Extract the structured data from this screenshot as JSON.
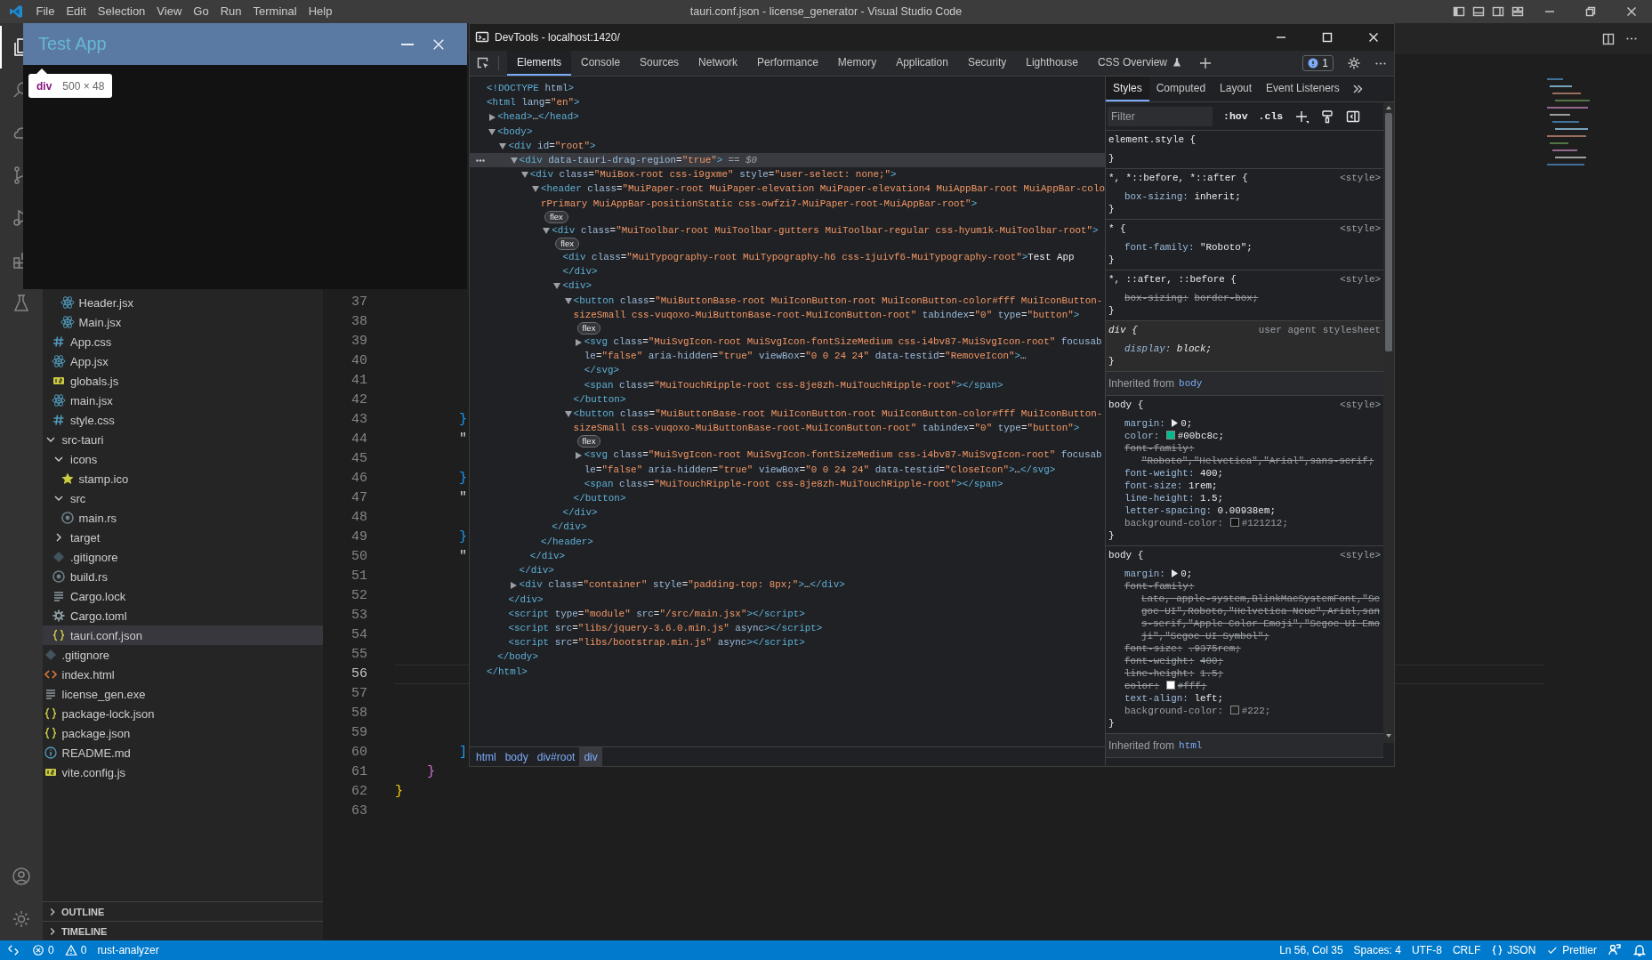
{
  "menubar": {
    "items": [
      "File",
      "Edit",
      "Selection",
      "View",
      "Go",
      "Run",
      "Terminal",
      "Help"
    ],
    "title": "tauri.conf.json - license_generator - Visual Studio Code"
  },
  "activity_bar": {
    "top": [
      {
        "kind": "explorer",
        "selected": true
      },
      {
        "kind": "search",
        "selected": false
      },
      {
        "kind": "remote",
        "selected": false
      },
      {
        "kind": "scm",
        "selected": false
      },
      {
        "kind": "debug",
        "selected": false
      },
      {
        "kind": "extensions",
        "selected": false
      },
      {
        "kind": "testing",
        "selected": false
      }
    ],
    "bottom": [
      {
        "kind": "account"
      },
      {
        "kind": "manage"
      }
    ]
  },
  "explorer": {
    "tree": [
      {
        "children": [
          {
            "children": [
              {
                "name": "Header.jsx",
                "kind": "react",
                "selected": false
              },
              {
                "name": "Main.jsx",
                "kind": "react",
                "selected": false
              }
            ]
          },
          {
            "name": "App.css",
            "kind": "css",
            "selected": false
          },
          {
            "name": "App.jsx",
            "kind": "react",
            "selected": false
          },
          {
            "name": "globals.js",
            "kind": "js",
            "selected": false
          },
          {
            "name": "main.jsx",
            "kind": "react",
            "selected": false
          },
          {
            "name": "style.css",
            "kind": "css",
            "selected": false
          }
        ]
      },
      {
        "name": "src-tauri",
        "kind": "folder",
        "expanded": true,
        "selected": false,
        "children": [
          {
            "name": "icons",
            "kind": "folder",
            "expanded": true,
            "selected": false,
            "children": [
              {
                "name": "stamp.ico",
                "kind": "image",
                "selected": false
              }
            ]
          },
          {
            "name": "src",
            "kind": "folder",
            "expanded": true,
            "selected": false,
            "children": [
              {
                "name": "main.rs",
                "kind": "rust",
                "selected": false
              }
            ]
          },
          {
            "name": "target",
            "kind": "folder",
            "expanded": false,
            "selected": false
          },
          {
            "name": ".gitignore",
            "kind": "git",
            "selected": false
          },
          {
            "name": "build.rs",
            "kind": "rust",
            "selected": false
          },
          {
            "name": "Cargo.lock",
            "kind": "lines",
            "selected": false
          },
          {
            "name": "Cargo.toml",
            "kind": "gear",
            "selected": false
          },
          {
            "name": "tauri.conf.json",
            "kind": "json",
            "selected": true
          }
        ]
      },
      {
        "name": ".gitignore",
        "kind": "git",
        "selected": false
      },
      {
        "name": "index.html",
        "kind": "html",
        "selected": false
      },
      {
        "name": "license_gen.exe",
        "kind": "lines",
        "selected": false
      },
      {
        "name": "package-lock.json",
        "kind": "json",
        "selected": false
      },
      {
        "name": "package.json",
        "kind": "json",
        "selected": false
      },
      {
        "name": "README.md",
        "kind": "info",
        "selected": false
      },
      {
        "name": "vite.config.js",
        "kind": "js",
        "selected": false
      }
    ],
    "sections": [
      {
        "label": "OUTLINE",
        "expanded": false
      },
      {
        "label": "TIMELINE",
        "expanded": false
      }
    ]
  },
  "editor": {
    "lines": [
      {
        "number": "37",
        "current": false
      },
      {
        "number": "38",
        "current": false
      },
      {
        "number": "39",
        "current": false
      },
      {
        "number": "40",
        "current": false
      },
      {
        "number": "41",
        "current": false
      },
      {
        "number": "42",
        "current": false
      },
      {
        "number": "43",
        "current": false,
        "text": "        }",
        "color": "#179fff"
      },
      {
        "number": "44",
        "current": false,
        "text": "        \""
      },
      {
        "number": "45",
        "current": false
      },
      {
        "number": "46",
        "current": false,
        "text": "        }",
        "color": "#179fff"
      },
      {
        "number": "47",
        "current": false,
        "text": "        \""
      },
      {
        "number": "48",
        "current": false
      },
      {
        "number": "49",
        "current": false,
        "text": "        }",
        "color": "#179fff"
      },
      {
        "number": "50",
        "current": false,
        "text": "        \""
      },
      {
        "number": "51",
        "current": false
      },
      {
        "number": "52",
        "current": false
      },
      {
        "number": "53",
        "current": false
      },
      {
        "number": "54",
        "current": false
      },
      {
        "number": "55",
        "current": false
      },
      {
        "number": "56",
        "current": true
      },
      {
        "number": "57",
        "current": false
      },
      {
        "number": "58",
        "current": false
      },
      {
        "number": "59",
        "current": false
      },
      {
        "number": "60",
        "current": false,
        "text": "        ]",
        "color": "#179fff"
      },
      {
        "number": "61",
        "current": false,
        "text": "    }",
        "color": "#da70d6"
      },
      {
        "number": "62",
        "current": false,
        "text": "}",
        "color": "#ffd700"
      },
      {
        "number": "63",
        "current": false
      }
    ]
  },
  "test_app": {
    "title": "Test App",
    "tooltip": {
      "tag": "div",
      "size": "500 × 48"
    }
  },
  "devtools": {
    "title": "DevTools - localhost:1420/",
    "tabs": [
      {
        "label": "Elements",
        "selected": true,
        "experimental": false
      },
      {
        "label": "Console",
        "selected": false,
        "experimental": false
      },
      {
        "label": "Sources",
        "selected": false,
        "experimental": false
      },
      {
        "label": "Network",
        "selected": false,
        "experimental": false
      },
      {
        "label": "Performance",
        "selected": false,
        "experimental": false
      },
      {
        "label": "Memory",
        "selected": false,
        "experimental": false
      },
      {
        "label": "Application",
        "selected": false,
        "experimental": false
      },
      {
        "label": "Security",
        "selected": false,
        "experimental": false
      },
      {
        "label": "Lighthouse",
        "selected": false,
        "experimental": false
      },
      {
        "label": "CSS Overview",
        "selected": false,
        "experimental": true
      }
    ],
    "issues": "1",
    "elements": {
      "tree": [
        {
          "open": "<!DOCTYPE html>",
          "selected": false
        },
        {
          "open": "<html lang=\"en\">",
          "selected": false,
          "close": "</html>",
          "children": [
            {
              "open": "<head>…</head>",
              "expanded": false,
              "selected": false
            },
            {
              "open": "<body>",
              "expanded": true,
              "selected": false,
              "close": "</body>",
              "children": [
                {
                  "open": "<div id=\"root\">",
                  "expanded": true,
                  "selected": false,
                  "close": "</div>",
                  "children": [
                    {
                      "open": "<div data-tauri-drag-region=\"true\">",
                      "suffix": "== $0",
                      "expanded": true,
                      "selected": true,
                      "close": "</div>",
                      "children": [
                        {
                          "open": "<div class=\"MuiBox-root css-i9gxme\" style=\"user-select: none;\">",
                          "expanded": true,
                          "selected": false,
                          "close": "</div>",
                          "children": [
                            {
                              "open": "<header class=\"MuiPaper-root MuiPaper-elevation MuiPaper-elevation4 MuiAppBar-root MuiAppBar-colorPrimary MuiAppBar-positionStatic css-owfzi7-MuiPaper-root-MuiAppBar-root\">",
                              "badge": "flex",
                              "expanded": true,
                              "selected": false,
                              "close": "</header>",
                              "children": [
                                {
                                  "open": "<div class=\"MuiToolbar-root MuiToolbar-gutters MuiToolbar-regular css-hyum1k-MuiToolbar-root\">",
                                  "badge": "flex",
                                  "expanded": true,
                                  "selected": false,
                                  "close": "</div>",
                                  "children": [
                                    {
                                      "open": "<div class=\"MuiTypography-root MuiTypography-h6 css-1juivf6-MuiTypography-root\">Test App",
                                      "selected": false,
                                      "close": "</div>"
                                    },
                                    {
                                      "open": "<div>",
                                      "expanded": true,
                                      "selected": false,
                                      "close": "</div>",
                                      "children": [
                                        {
                                          "open": "<button class=\"MuiButtonBase-root MuiIconButton-root MuiIconButton-color#fff MuiIconButton-sizeSmall css-vuqoxo-MuiButtonBase-root-MuiIconButton-root\" tabindex=\"0\" type=\"button\">",
                                          "badge": "flex",
                                          "expanded": true,
                                          "selected": false,
                                          "close": "</button>",
                                          "children": [
                                            {
                                              "open": "<svg class=\"MuiSvgIcon-root MuiSvgIcon-fontSizeMedium css-i4bv87-MuiSvgIcon-root\" focusable=\"false\" aria-hidden=\"true\" viewBox=\"0 0 24 24\" data-testid=\"RemoveIcon\">…",
                                              "expanded": false,
                                              "selected": false,
                                              "close": "</svg>"
                                            },
                                            {
                                              "open": "<span class=\"MuiTouchRipple-root css-8je8zh-MuiTouchRipple-root\"></span>",
                                              "selected": false
                                            }
                                          ]
                                        },
                                        {
                                          "open": "<button class=\"MuiButtonBase-root MuiIconButton-root MuiIconButton-color#fff MuiIconButton-sizeSmall css-vuqoxo-MuiButtonBase-root-MuiIconButton-root\" tabindex=\"0\" type=\"button\">",
                                          "badge": "flex",
                                          "expanded": true,
                                          "selected": false,
                                          "close": "</button>",
                                          "children": [
                                            {
                                              "open": "<svg class=\"MuiSvgIcon-root MuiSvgIcon-fontSizeMedium css-i4bv87-MuiSvgIcon-root\" focusable=\"false\" aria-hidden=\"true\" viewBox=\"0 0 24 24\" data-testid=\"CloseIcon\">…</svg>",
                                              "expanded": false,
                                              "selected": false
                                            },
                                            {
                                              "open": "<span class=\"MuiTouchRipple-root css-8je8zh-MuiTouchRipple-root\"></span>",
                                              "selected": false
                                            }
                                          ]
                                        }
                                      ]
                                    }
                                  ]
                                }
                              ]
                            }
                          ]
                        }
                      ]
                    },
                    {
                      "open": "<div class=\"container\" style=\"padding-top: 8px;\">…</div>",
                      "expanded": false,
                      "selected": false
                    }
                  ]
                },
                {
                  "open": "<script type=\"module\" src=\"/src/main.jsx\"></script>",
                  "selected": false
                },
                {
                  "open": "<script src=\"libs/jquery-3.6.0.min.js\" async></script>",
                  "selected": false
                },
                {
                  "open": "<script src=\"libs/bootstrap.min.js\" async></script>",
                  "selected": false
                }
              ]
            }
          ]
        }
      ],
      "breadcrumbs": [
        {
          "label": "html",
          "selected": false
        },
        {
          "label": "body",
          "selected": false
        },
        {
          "label": "div#root",
          "selected": false
        },
        {
          "label": "div",
          "selected": true
        }
      ]
    },
    "styles": {
      "tabs": [
        {
          "label": "Styles",
          "selected": true
        },
        {
          "label": "Computed",
          "selected": false
        },
        {
          "label": "Layout",
          "selected": false
        },
        {
          "label": "Event Listeners",
          "selected": false
        }
      ],
      "filter_placeholder": "Filter",
      "hov": ":hov",
      "cls": ".cls",
      "blocks": [
        {
          "kind": "rule",
          "selector": "element.style {",
          "user_agent": false,
          "close": "}"
        },
        {
          "kind": "rule",
          "selector": "*, *::before, *::after {",
          "source": "<style>",
          "user_agent": false,
          "close": "}",
          "declarations": [
            {
              "property": "box-sizing:",
              "value": "inherit;",
              "struck": false,
              "dimmed": false,
              "expandable": false
            }
          ]
        },
        {
          "kind": "rule",
          "selector": "* {",
          "source": "<style>",
          "user_agent": false,
          "close": "}",
          "declarations": [
            {
              "property": "font-family:",
              "value": "\"Roboto\";",
              "struck": false,
              "dimmed": false,
              "expandable": false
            }
          ]
        },
        {
          "kind": "rule",
          "selector": "*, ::after, ::before {",
          "source": "<style>",
          "user_agent": false,
          "close": "}",
          "declarations": [
            {
              "property": "box-sizing:",
              "value": "border-box;",
              "struck": true,
              "dimmed": false,
              "expandable": false
            }
          ]
        },
        {
          "kind": "rule",
          "selector": "div {",
          "source": "user agent stylesheet",
          "user_agent": true,
          "close": "}",
          "declarations": [
            {
              "property": "display:",
              "value": "block;",
              "struck": false,
              "dimmed": false,
              "expandable": false
            }
          ]
        },
        {
          "kind": "inherited",
          "label": "Inherited from",
          "link": "body"
        },
        {
          "kind": "rule",
          "selector": "body {",
          "source": "<style>",
          "user_agent": false,
          "close": "}",
          "declarations": [
            {
              "property": "margin:",
              "value": "0;",
              "struck": false,
              "dimmed": false,
              "expandable": true
            },
            {
              "property": "color:",
              "value": "#00bc8c;",
              "color": "#00bc8c",
              "struck": false,
              "dimmed": false,
              "expandable": false
            },
            {
              "property": "font-family:",
              "value": "\"Roboto\",\"Helvetica\",\"Arial\",sans-serif;",
              "struck": true,
              "dimmed": false,
              "expandable": false
            },
            {
              "property": "font-weight:",
              "value": "400;",
              "struck": false,
              "dimmed": false,
              "expandable": false
            },
            {
              "property": "font-size:",
              "value": "1rem;",
              "struck": false,
              "dimmed": false,
              "expandable": false
            },
            {
              "property": "line-height:",
              "value": "1.5;",
              "struck": false,
              "dimmed": false,
              "expandable": false
            },
            {
              "property": "letter-spacing:",
              "value": "0.00938em;",
              "struck": false,
              "dimmed": false,
              "expandable": false
            },
            {
              "property": "background-color:",
              "value": "#121212;",
              "color": "#121212",
              "struck": false,
              "dimmed": true,
              "expandable": false
            }
          ]
        },
        {
          "kind": "rule",
          "selector": "body {",
          "source": "<style>",
          "user_agent": false,
          "close": "}",
          "declarations": [
            {
              "property": "margin:",
              "value": "0;",
              "struck": false,
              "dimmed": false,
              "expandable": true
            },
            {
              "property": "font-family:",
              "value": "Lato, apple-system,BlinkMacSystemFont,\"Segoe UI\",Roboto,\"Helvetica Neue\",Arial,sans-serif,\"Apple Color Emoji\",\"Segoe UI Emoji\",\"Segoe UI Symbol\";",
              "struck": true,
              "dimmed": false,
              "expandable": false
            },
            {
              "property": "font-size:",
              "value": ".9375rem;",
              "struck": true,
              "dimmed": false,
              "expandable": false
            },
            {
              "property": "font-weight:",
              "value": "400;",
              "struck": true,
              "dimmed": false,
              "expandable": false
            },
            {
              "property": "line-height:",
              "value": "1.5;",
              "struck": true,
              "dimmed": false,
              "expandable": false
            },
            {
              "property": "color:",
              "value": "#fff;",
              "color": "#ffffff",
              "struck": true,
              "dimmed": false,
              "expandable": false
            },
            {
              "property": "text-align:",
              "value": "left;",
              "struck": false,
              "dimmed": false,
              "expandable": false
            },
            {
              "property": "background-color:",
              "value": "#222;",
              "color": "#222222",
              "struck": false,
              "dimmed": true,
              "expandable": false
            }
          ]
        },
        {
          "kind": "inherited",
          "label": "Inherited from",
          "link": "html"
        }
      ]
    }
  },
  "status_bar": {
    "left": [
      {
        "kind": "remote"
      },
      {
        "kind": "errors",
        "text": "0"
      },
      {
        "kind": "warnings",
        "text": "0"
      },
      {
        "kind": "text",
        "text": "rust-analyzer"
      }
    ],
    "right": [
      {
        "kind": "text",
        "text": "Ln 56, Col 35"
      },
      {
        "kind": "text",
        "text": "Spaces: 4"
      },
      {
        "kind": "text",
        "text": "UTF-8"
      },
      {
        "kind": "text",
        "text": "CRLF"
      },
      {
        "kind": "language",
        "text": "JSON"
      },
      {
        "kind": "prettier",
        "text": "Prettier"
      },
      {
        "kind": "feedback"
      },
      {
        "kind": "bell"
      }
    ]
  }
}
